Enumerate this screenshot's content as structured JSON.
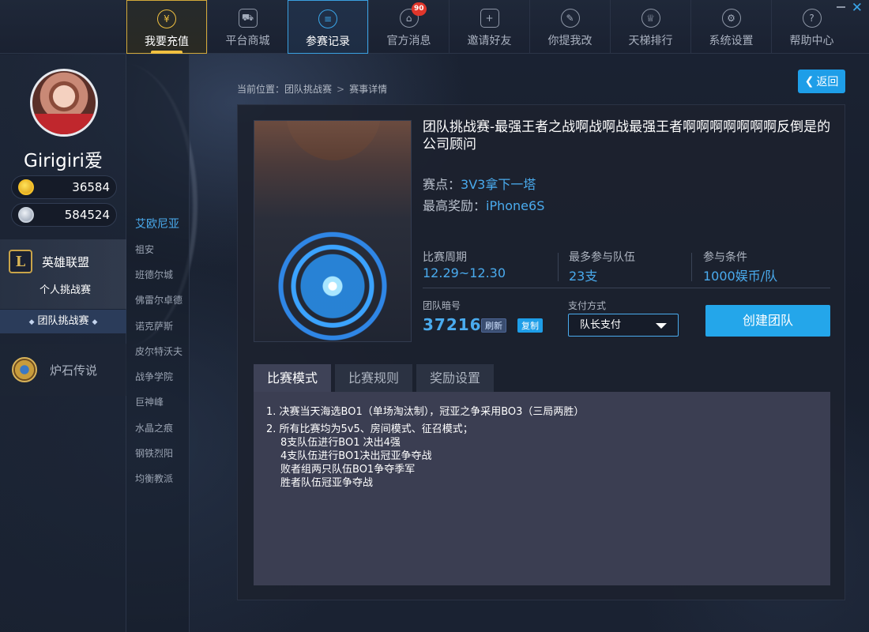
{
  "nav": {
    "items": [
      {
        "label": "我要充值",
        "icon": "yuan-icon"
      },
      {
        "label": "平台商城",
        "icon": "cart-icon"
      },
      {
        "label": "参赛记录",
        "icon": "document-icon"
      },
      {
        "label": "官方消息",
        "icon": "home-message-icon",
        "badge": "90"
      },
      {
        "label": "邀请好友",
        "icon": "add-user-icon"
      },
      {
        "label": "你提我改",
        "icon": "pencil-icon"
      },
      {
        "label": "天梯排行",
        "icon": "trophy-icon"
      },
      {
        "label": "系统设置",
        "icon": "gear-icon"
      },
      {
        "label": "帮助中心",
        "icon": "question-icon"
      }
    ],
    "close_symbol": "✕"
  },
  "user": {
    "name": "Girigiri爱",
    "gold": "36584",
    "silver": "584524"
  },
  "games": {
    "lol": {
      "label": "英雄联盟",
      "logo_letter": "L",
      "sub_personal": "个人挑战赛",
      "sub_team": "团队挑战赛",
      "sub_team_marker": "◆"
    },
    "hs": {
      "label": "炉石传说"
    }
  },
  "servers": [
    "艾欧尼亚",
    "祖安",
    "班德尔城",
    "佛雷尔卓德",
    "诺克萨斯",
    "皮尔特沃夫",
    "战争学院",
    "巨神峰",
    "水晶之痕",
    "钢铁烈阳",
    "均衡教派"
  ],
  "breadcrumb": {
    "prefix": "当前位置：",
    "parent": "团队挑战赛",
    "sep": ">",
    "current": "赛事详情"
  },
  "back": {
    "arrow": "❮",
    "label": "返回"
  },
  "match": {
    "title": "团队挑战赛-最强王者之战啊战啊战最强王者啊啊啊啊啊啊啊反倒是的公司顾问",
    "point_label": "赛点：",
    "point_value": "3V3拿下一塔",
    "prize_label": "最高奖励：",
    "prize_value": "iPhone6S",
    "period_label": "比赛周期",
    "period_value": "12.29~12.30",
    "teams_label": "最多参与队伍",
    "teams_value": "23支",
    "cond_label": "参与条件",
    "cond_value": "1000娱币/队",
    "pwd_label": "团队暗号",
    "pwd_value": "37216",
    "refresh_label": "刷新",
    "copy_label": "复制",
    "pay_label": "支付方式",
    "pay_value": "队长支付",
    "create_label": "创建团队"
  },
  "tabs": [
    "比赛模式",
    "比赛规则",
    "奖励设置"
  ],
  "rules": [
    [
      "1. 决赛当天海选BO1（单场淘汰制），冠亚之争采用BO3（三局两胜）"
    ],
    [
      "2. 所有比赛均为5v5、房间模式、征召模式；",
      "8支队伍进行BO1 决出4强",
      "4支队伍进行BO1决出冠亚争夺战",
      "败者组两只队伍BO1争夺季军",
      "胜者队伍冠亚争夺战"
    ]
  ],
  "colors": {
    "accent": "#24a6ea",
    "gold": "#f0c040",
    "badge": "#e0362b"
  }
}
